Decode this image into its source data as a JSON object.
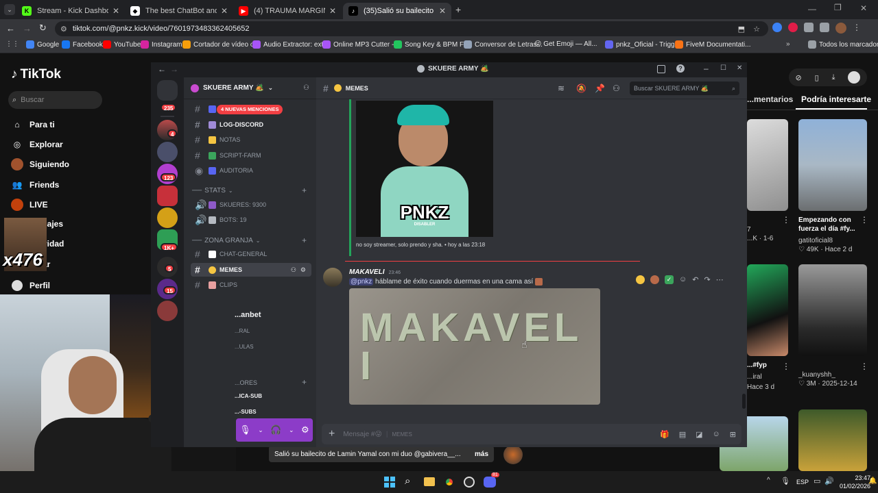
{
  "browser": {
    "tabs": [
      {
        "title": "Stream - Kick Dashboard",
        "active": false
      },
      {
        "title": "The best ChatBot and Widgets",
        "active": false
      },
      {
        "title": "(4) TRAUMA MARGINAL - PNK",
        "active": false
      },
      {
        "title": "(35)Salió su bailecito de Lamin",
        "active": true
      }
    ],
    "url": "tiktok.com/@pnkz.kick/video/7601973483362405652",
    "bookmarks": [
      "Google",
      "Facebook",
      "YouTube",
      "Instagram",
      "Cortador de vídeo o...",
      "Audio Extractor: ext...",
      "Online MP3 Cutter -...",
      "Song Key & BPM Fi...",
      "Conversor de Letras...",
      "😜 Get Emoji — All...",
      "pnkz_Oficial - Trigg...",
      "FiveM Documentati..."
    ],
    "all_bookmarks": "Todos los marcadores"
  },
  "tiktok": {
    "logo": "TikTok",
    "search_placeholder": "Buscar",
    "nav": [
      "Para ti",
      "Explorar",
      "Siguiendo",
      "Friends",
      "LIVE",
      "...sajes",
      "...vidad",
      "...ar",
      "Perfil"
    ],
    "tabs": [
      "...mentarios",
      "Podría interesarte"
    ],
    "cards": [
      {
        "title": "",
        "user": "",
        "meta": "...K · 1-6",
        "num": "7"
      },
      {
        "title": "Empezando con fuerza el día #fy...",
        "user": "gatitoficial8",
        "likes": "49K",
        "date": "Hace 2 d"
      },
      {
        "title": "...#fyp",
        "user": "...iral",
        "meta": "Hace 3 d"
      },
      {
        "title": "",
        "user": "_kuanyshh_",
        "likes": "3M",
        "date": "2025-12-14"
      }
    ],
    "video_caption": "Salió su bailecito de Lamin Yamal con mi duo @gabivera__...",
    "more": "más",
    "overlay_counter": "x476"
  },
  "discord": {
    "window_title": "SKUERE ARMY 🏕️",
    "server_name": "SKUERE ARMY 🏕️",
    "mentions_pill": "4 NUEVAS MENCIONES",
    "guild_badges": [
      "235",
      "4",
      "123",
      "1K+",
      "5",
      "15"
    ],
    "channels_top": [
      {
        "name": "LOG-DISCORD",
        "color": "#a08bd7"
      },
      {
        "name": "NOTAS",
        "color": "#f5c542"
      },
      {
        "name": "SCRIPT-FARM",
        "color": "#3ba55c"
      },
      {
        "name": "AUDITORIA",
        "color": "#5865f2"
      }
    ],
    "cat_stats": "STATS",
    "stat_skueres": "SKUERES: 9300",
    "stat_bots": "BOTS: 19",
    "cat_granja": "ZONA GRANJA",
    "channels_granja": [
      {
        "name": "CHAT-GENERAL",
        "color": "#ffffff",
        "selected": false
      },
      {
        "name": "MEMES",
        "color": "#f5c542",
        "selected": true
      },
      {
        "name": "CLIPS",
        "color": "#e8a0a0",
        "selected": false
      }
    ],
    "partial_channels": [
      "...anbet",
      "...RAL",
      "...ULAS",
      "...ORES",
      "...ICA-SUB",
      "...-SUBS"
    ],
    "current_channel": "MEMES",
    "search_placeholder": "Buscar SKUERE ARMY 🏕️",
    "embed_logo": "PNKZ",
    "embed_logo_sub": "DISABLER",
    "embed_caption": "no soy streamer, solo prendo y sha. • hoy a las 23:18",
    "message": {
      "author": "MAKAVELI",
      "time": "23:46",
      "mention": "@pnkz",
      "text": " háblame de éxito cuando duermas en una cama así",
      "money_text": "MAKAVELI"
    },
    "composer_placeholder": "Mensaje #😜",
    "composer_channel": "MEMES"
  },
  "taskbar": {
    "lang": "ESP",
    "time": "23:47",
    "date": "01/02/2026",
    "discord_badge": "81"
  },
  "colors": {
    "discord_accent": "#5865f2",
    "mention_red": "#f23f43",
    "voice_purple": "#8c3cc8",
    "chrome_dark": "#202124"
  }
}
